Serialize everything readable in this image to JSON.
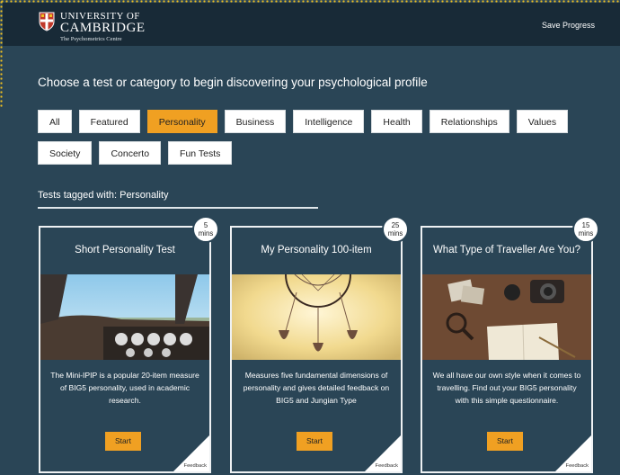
{
  "header": {
    "brand_line1": "UNIVERSITY OF",
    "brand_line2": "CAMBRIDGE",
    "brand_line3": "The Psychometrics Centre",
    "save_label": "Save Progress"
  },
  "headline": "Choose a test or category to begin discovering your psychological profile",
  "filters": {
    "row1": [
      "All",
      "Featured",
      "Personality",
      "Business",
      "Intelligence",
      "Health",
      "Relationships",
      "Values"
    ],
    "row2": [
      "Society",
      "Concerto",
      "Fun Tests"
    ],
    "active": "Personality"
  },
  "tagged_label": "Tests tagged with: Personality",
  "cards": [
    {
      "title": "Short Personality Test",
      "duration_num": "5",
      "duration_unit": "mins",
      "description": "The Mini-IPIP is a popular 20-item measure of BIG5 personality, used in academic research.",
      "start_label": "Start",
      "feedback_label": "Feedback"
    },
    {
      "title": "My Personality 100-item",
      "duration_num": "25",
      "duration_unit": "mins",
      "description": "Measures five fundamental dimensions of personality and gives detailed feedback on BIG5 and Jungian Type",
      "start_label": "Start",
      "feedback_label": "Feedback"
    },
    {
      "title": "What Type of Traveller Are You?",
      "duration_num": "15",
      "duration_unit": "mins",
      "description": "We all have our own style when it comes to travelling. Find out your BIG5 personality with this simple questionnaire.",
      "start_label": "Start",
      "feedback_label": "Feedback"
    }
  ],
  "colors": {
    "background": "#2a4556",
    "header": "#182a37",
    "accent": "#f0a022"
  }
}
